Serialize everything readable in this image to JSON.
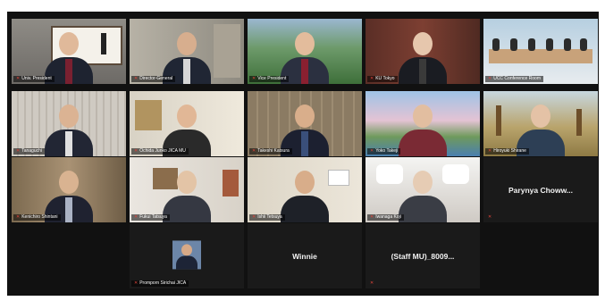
{
  "participants": [
    {
      "name": "Univ. President",
      "mic_muted": true
    },
    {
      "name": "Director-General",
      "mic_muted": true
    },
    {
      "name": "Vice President",
      "mic_muted": true
    },
    {
      "name": "KU Tokyo",
      "mic_muted": true
    },
    {
      "name": "UCC Conference Room",
      "mic_muted": true
    },
    {
      "name": "Tanaguchi",
      "mic_muted": true
    },
    {
      "name": "Ochida Junko JICA MU",
      "mic_muted": true
    },
    {
      "name": "Takeshi Katsura",
      "mic_muted": true
    },
    {
      "name": "Yoko Takeji",
      "mic_muted": true
    },
    {
      "name": "Hiroyuki Shirane",
      "mic_muted": true
    },
    {
      "name": "Kenichiro Shintani",
      "mic_muted": true
    },
    {
      "name": "Fukui Tatsuya",
      "mic_muted": true
    },
    {
      "name": "Ishii Tetsuya",
      "mic_muted": true
    },
    {
      "name": "Iwanaga Koji",
      "mic_muted": true
    },
    {
      "name": "Parynya Choww...",
      "mic_muted": false
    },
    {
      "name": "Promporn Sirichai JICA",
      "mic_muted": true
    },
    {
      "name": "Winnie",
      "mic_muted": false
    },
    {
      "name": "(Staff MU)_8009...",
      "mic_muted": true
    }
  ],
  "colors": {
    "background": "#111111",
    "muted_mic": "#e0443a"
  }
}
